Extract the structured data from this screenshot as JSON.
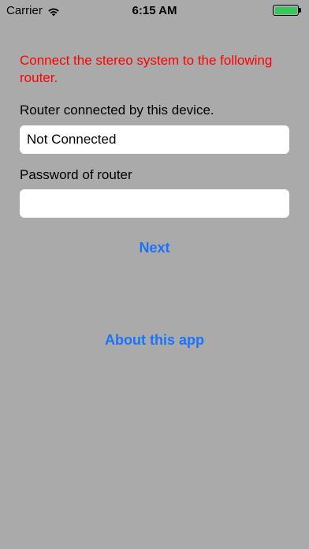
{
  "status_bar": {
    "carrier": "Carrier",
    "time": "6:15 AM",
    "wifi_icon": "wifi-icon",
    "battery_icon": "battery-icon",
    "battery_level": 1.0,
    "battery_color": "#34c759"
  },
  "main": {
    "instruction": "Connect the stereo system to the following router.",
    "router_label": "Router connected by this device.",
    "router_value": "Not Connected",
    "password_label": "Password of router",
    "password_value": "",
    "next_label": "Next",
    "about_label": "About this app"
  },
  "colors": {
    "background": "#aaaaaa",
    "instruction": "#ff0000",
    "accent": "#1a73ff"
  }
}
